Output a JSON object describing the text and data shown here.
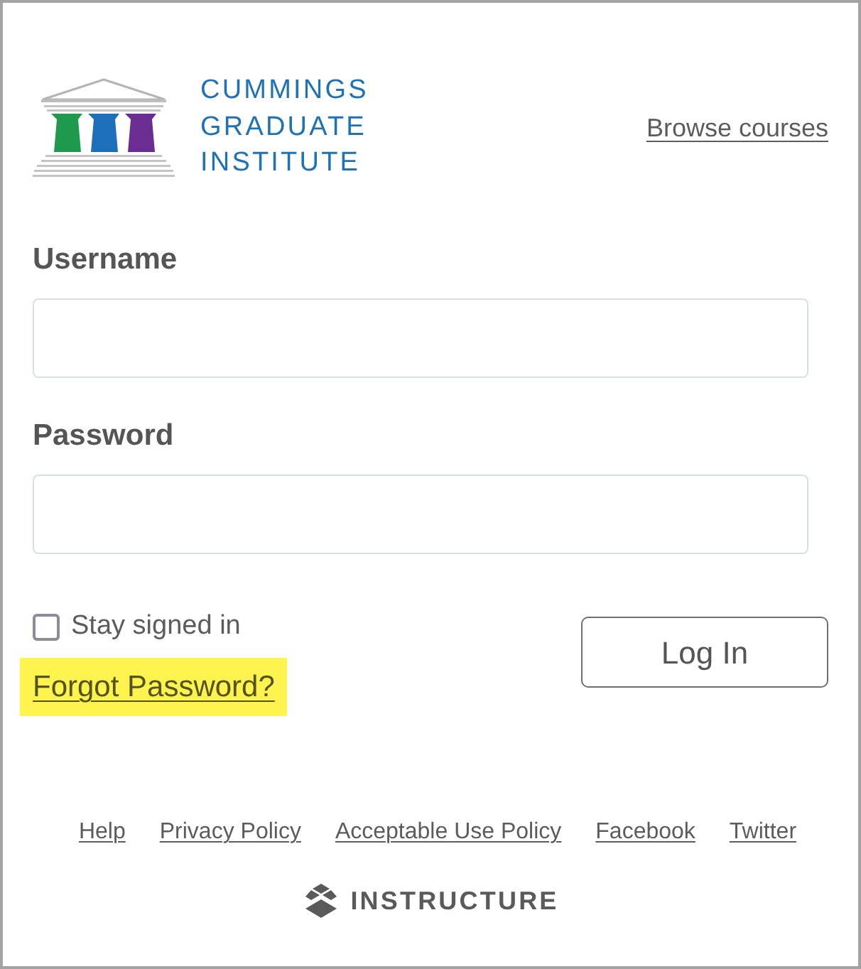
{
  "logo": {
    "lines": [
      "CUMMINGS",
      "GRADUATE",
      "INSTITUTE"
    ]
  },
  "header_link": "Browse courses",
  "fields": [
    {
      "label": "Username"
    },
    {
      "label": "Password"
    }
  ],
  "stay_signed_in": {
    "label": "Stay signed in",
    "checked": false
  },
  "forgot_password": {
    "label": "Forgot Password?",
    "highlighted": true
  },
  "login_button": "Log In",
  "footer_links": [
    "Help",
    "Privacy Policy",
    "Acceptable Use Policy",
    "Facebook",
    "Twitter"
  ],
  "brand": "INSTRUCTURE"
}
